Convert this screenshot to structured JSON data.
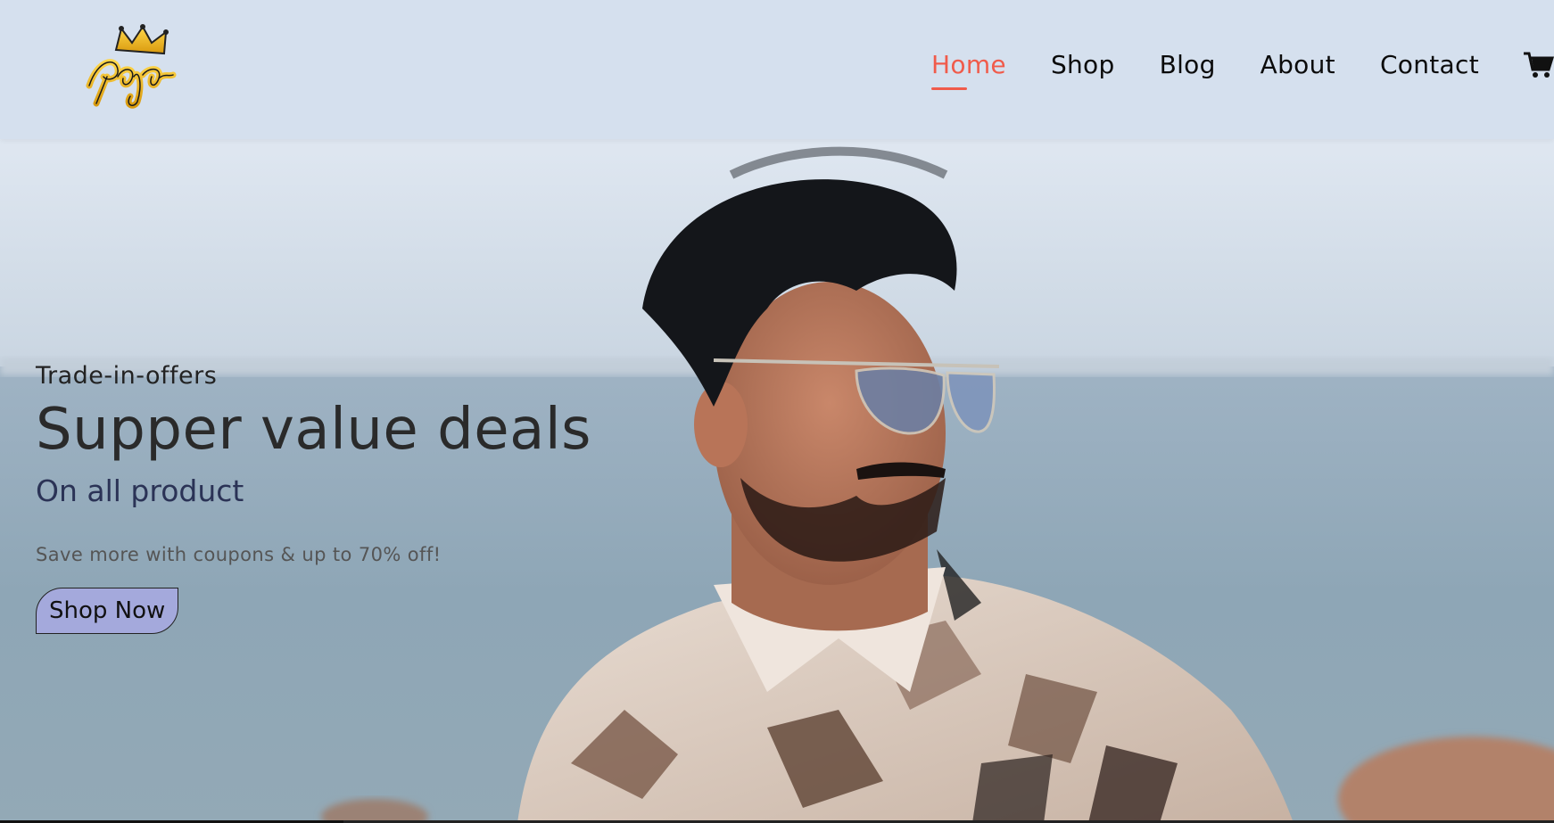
{
  "brand": {
    "logo_text": "Raja"
  },
  "nav": {
    "items": [
      {
        "label": "Home",
        "active": true
      },
      {
        "label": "Shop",
        "active": false
      },
      {
        "label": "Blog",
        "active": false
      },
      {
        "label": "About",
        "active": false
      },
      {
        "label": "Contact",
        "active": false
      }
    ],
    "cart_icon": "shopping-cart-icon"
  },
  "hero": {
    "kicker": "Trade-in-offers",
    "headline": "Supper value deals",
    "subhead": "On all product",
    "description": "Save more with coupons & up to 70% off!",
    "cta_label": "Shop Now"
  },
  "colors": {
    "accent": "#f05b4b",
    "header_bg": "#d5e0ee",
    "button_bg": "#a4a9dc",
    "subhead": "#2b3356"
  }
}
